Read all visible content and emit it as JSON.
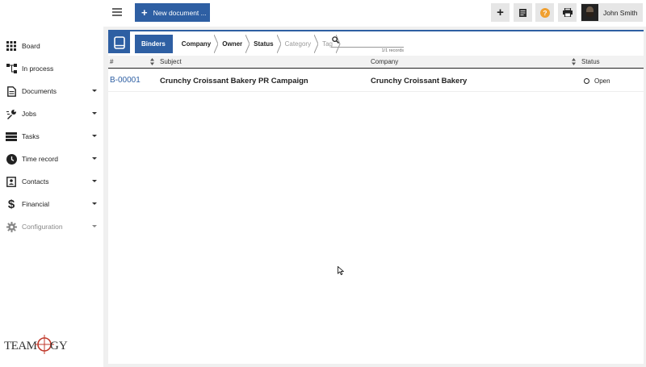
{
  "app": {
    "logo_text": "TEAMOGY"
  },
  "sidebar": {
    "items": [
      {
        "label": "Board",
        "icon": "grid-icon",
        "has_caret": false
      },
      {
        "label": "In process",
        "icon": "flow-icon",
        "has_caret": false
      },
      {
        "label": "Documents",
        "icon": "document-icon",
        "has_caret": true
      },
      {
        "label": "Jobs",
        "icon": "wrench-icon",
        "has_caret": true
      },
      {
        "label": "Tasks",
        "icon": "tasks-icon",
        "has_caret": true
      },
      {
        "label": "Time record",
        "icon": "clock-icon",
        "has_caret": true
      },
      {
        "label": "Contacts",
        "icon": "contact-card-icon",
        "has_caret": true
      },
      {
        "label": "Financial",
        "icon": "dollar-icon",
        "has_caret": true
      },
      {
        "label": "Configuration",
        "icon": "gear-icon",
        "has_caret": true
      }
    ]
  },
  "toolbar": {
    "new_document_label": "New document ...",
    "buttons": [
      "add-icon",
      "notes-icon",
      "help-icon",
      "print-icon"
    ],
    "help_color": "#f0a030",
    "user_name": "John Smith"
  },
  "filters": {
    "crumbs": [
      "Binders",
      "Company",
      "Owner",
      "Status",
      "Category",
      "Tag"
    ],
    "search_placeholder": "",
    "records_label": "1/1 records"
  },
  "table": {
    "headers": {
      "id": "#",
      "subject": "Subject",
      "company": "Company",
      "status": "Status"
    },
    "rows": [
      {
        "id": "B-00001",
        "subject": "Crunchy Croissant Bakery PR Campaign",
        "company": "Crunchy Croissant Bakery",
        "status": "Open"
      }
    ]
  },
  "colors": {
    "accent": "#2e5fa3",
    "logo_red": "#c0392b"
  }
}
